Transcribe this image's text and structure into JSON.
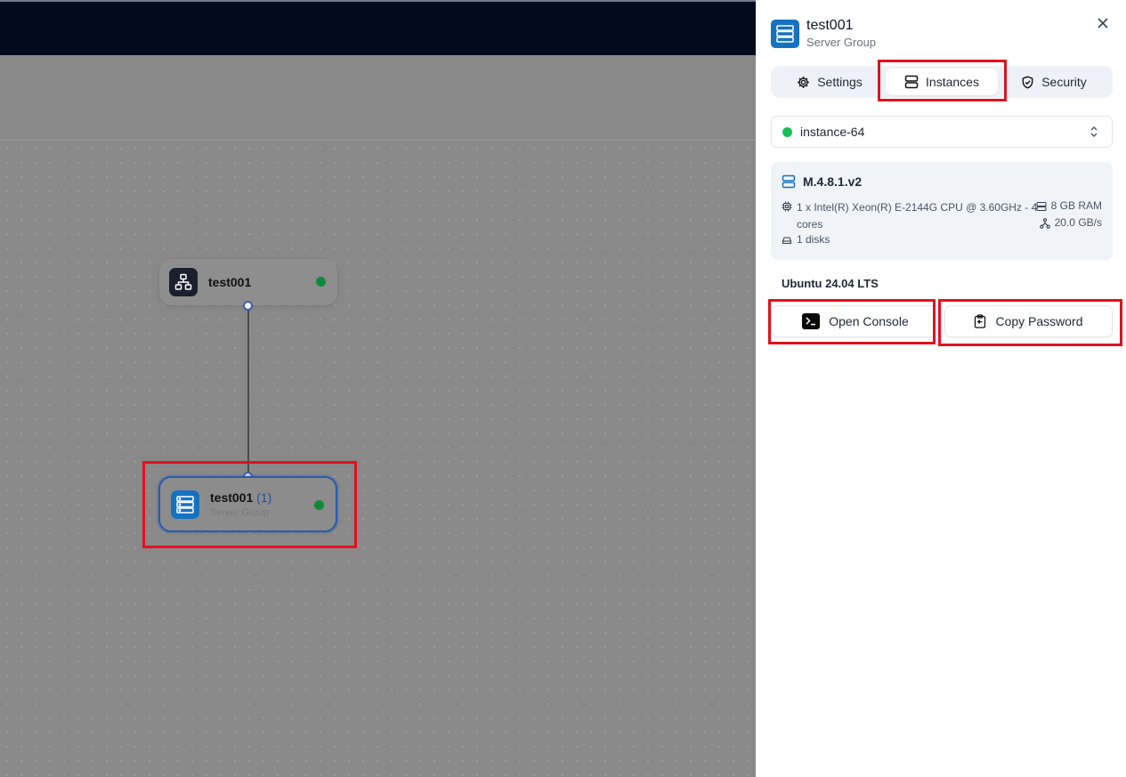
{
  "canvas": {
    "nodes": [
      {
        "title": "test001",
        "status_color": "#0f8a3a",
        "icon": "network-icon"
      },
      {
        "title": "test001",
        "count": "(1)",
        "subtitle": "Server Group",
        "status_color": "#0f8a3a",
        "icon": "server-stack-icon"
      }
    ]
  },
  "panel": {
    "title": "test001",
    "subtitle": "Server Group",
    "close_icon": "close-icon",
    "tabs": [
      {
        "label": "Settings",
        "icon": "gear-icon",
        "active": false
      },
      {
        "label": "Instances",
        "icon": "server-icon",
        "active": true
      },
      {
        "label": "Security",
        "icon": "shield-icon",
        "active": false
      }
    ],
    "instance_select": {
      "value": "instance-64",
      "status_color": "#16c05a"
    },
    "spec_card": {
      "name": "M.4.8.1.v2",
      "cpu": "1 x Intel(R) Xeon(R) E-2144G CPU @ 3.60GHz - 4 cores",
      "ram": "8 GB RAM",
      "network": "20.0 GB/s",
      "disks": "1 disks"
    },
    "os": "Ubuntu 24.04 LTS",
    "buttons": {
      "open_console": "Open Console",
      "copy_password": "Copy Password"
    }
  },
  "colors": {
    "accent_blue": "#1572c0",
    "highlight_red": "#e0121e",
    "topbar": "#020a1f"
  }
}
